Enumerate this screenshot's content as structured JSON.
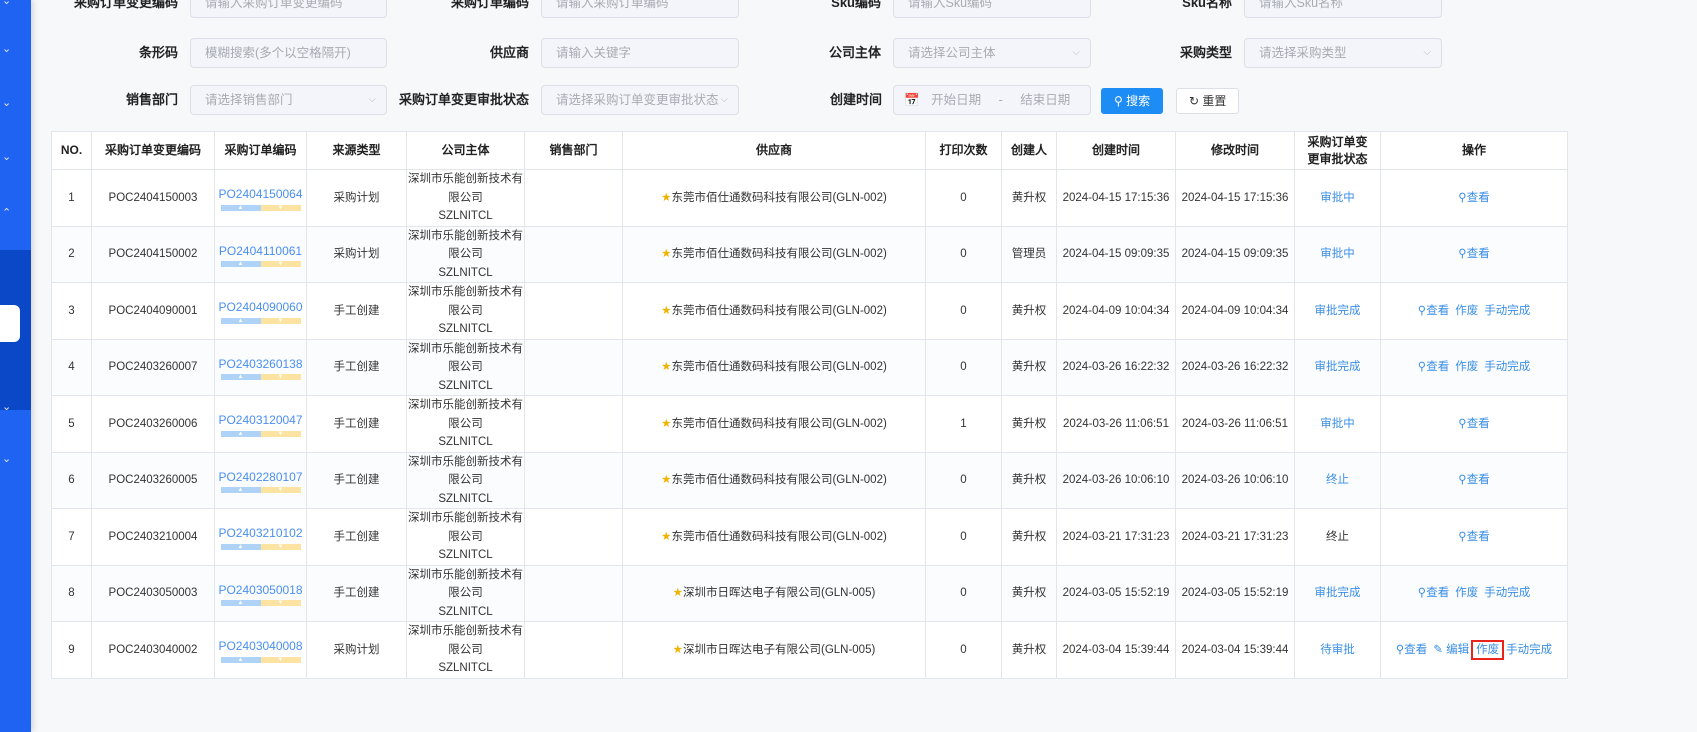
{
  "filters": [
    {
      "label": "采购订单变更编码",
      "placeholder": "请输入采购订单变更编码",
      "select": false
    },
    {
      "label": "采购订单编码",
      "placeholder": "请输入采购订单编码",
      "select": false
    },
    {
      "label": "Sku编码",
      "placeholder": "请输入Sku编码",
      "select": false
    },
    {
      "label": "Sku名称",
      "placeholder": "请输入Sku名称",
      "select": false
    },
    {
      "label": "条形码",
      "placeholder": "模糊搜索(多个以空格隔开)",
      "select": false
    },
    {
      "label": "供应商",
      "placeholder": "请输入关键字",
      "select": false
    },
    {
      "label": "公司主体",
      "placeholder": "请选择公司主体",
      "select": true
    },
    {
      "label": "采购类型",
      "placeholder": "请选择采购类型",
      "select": true
    },
    {
      "label": "销售部门",
      "placeholder": "请选择销售部门",
      "select": true
    },
    {
      "label": "采购订单变更审批状态",
      "placeholder": "请选择采购订单变更审批状态",
      "select": true
    }
  ],
  "date_filter": {
    "label": "创建时间",
    "start": "开始日期",
    "sep": "-",
    "end": "结束日期"
  },
  "buttons": {
    "search": "搜索",
    "reset": "重置"
  },
  "columns": [
    "NO.",
    "采购订单变更编码",
    "采购订单编码",
    "来源类型",
    "公司主体",
    "销售部门",
    "供应商",
    "打印次数",
    "创建人",
    "创建时间",
    "修改时间",
    "采购订单变更审批状态",
    "操作"
  ],
  "company": [
    "深圳市乐能创新技术有",
    "限公司",
    "SZLNITCL"
  ],
  "rows": [
    {
      "no": "1",
      "change_code": "POC2404150003",
      "po": "PO2404150064",
      "source": "采购计划",
      "dept": "",
      "supplier": "东莞市佰仕通数码科技有限公司(GLN-002)",
      "prints": "0",
      "creator": "黄升权",
      "created": "2024-04-15 17:15:36",
      "modified": "2024-04-15 17:15:36",
      "status": "审批中",
      "status_plain": false,
      "actions": [
        "查看"
      ]
    },
    {
      "no": "2",
      "change_code": "POC2404150002",
      "po": "PO2404110061",
      "source": "采购计划",
      "dept": "",
      "supplier": "东莞市佰仕通数码科技有限公司(GLN-002)",
      "prints": "0",
      "creator": "管理员",
      "created": "2024-04-15 09:09:35",
      "modified": "2024-04-15 09:09:35",
      "status": "审批中",
      "status_plain": false,
      "actions": [
        "查看"
      ]
    },
    {
      "no": "3",
      "change_code": "POC2404090001",
      "po": "PO2404090060",
      "source": "手工创建",
      "dept": "",
      "supplier": "东莞市佰仕通数码科技有限公司(GLN-002)",
      "prints": "0",
      "creator": "黄升权",
      "created": "2024-04-09 10:04:34",
      "modified": "2024-04-09 10:04:34",
      "status": "审批完成",
      "status_plain": false,
      "actions": [
        "查看",
        "作废",
        "手动完成"
      ]
    },
    {
      "no": "4",
      "change_code": "POC2403260007",
      "po": "PO2403260138",
      "source": "手工创建",
      "dept": "",
      "supplier": "东莞市佰仕通数码科技有限公司(GLN-002)",
      "prints": "0",
      "creator": "黄升权",
      "created": "2024-03-26 16:22:32",
      "modified": "2024-03-26 16:22:32",
      "status": "审批完成",
      "status_plain": false,
      "actions": [
        "查看",
        "作废",
        "手动完成"
      ]
    },
    {
      "no": "5",
      "change_code": "POC2403260006",
      "po": "PO2403120047",
      "source": "手工创建",
      "dept": "",
      "supplier": "东莞市佰仕通数码科技有限公司(GLN-002)",
      "prints": "1",
      "creator": "黄升权",
      "created": "2024-03-26 11:06:51",
      "modified": "2024-03-26 11:06:51",
      "status": "审批中",
      "status_plain": false,
      "actions": [
        "查看"
      ]
    },
    {
      "no": "6",
      "change_code": "POC2403260005",
      "po": "PO2402280107",
      "source": "手工创建",
      "dept": "",
      "supplier": "东莞市佰仕通数码科技有限公司(GLN-002)",
      "prints": "0",
      "creator": "黄升权",
      "created": "2024-03-26 10:06:10",
      "modified": "2024-03-26 10:06:10",
      "status": "终止",
      "status_plain": false,
      "actions": [
        "查看"
      ]
    },
    {
      "no": "7",
      "change_code": "POC2403210004",
      "po": "PO2403210102",
      "source": "手工创建",
      "dept": "",
      "supplier": "东莞市佰仕通数码科技有限公司(GLN-002)",
      "prints": "0",
      "creator": "黄升权",
      "created": "2024-03-21 17:31:23",
      "modified": "2024-03-21 17:31:23",
      "status": "终止",
      "status_plain": true,
      "actions": [
        "查看"
      ]
    },
    {
      "no": "8",
      "change_code": "POC2403050003",
      "po": "PO2403050018",
      "source": "手工创建",
      "dept": "",
      "supplier": "深圳市日晖达电子有限公司(GLN-005)",
      "prints": "0",
      "creator": "黄升权",
      "created": "2024-03-05 15:52:19",
      "modified": "2024-03-05 15:52:19",
      "status": "审批完成",
      "status_plain": false,
      "actions": [
        "查看",
        "作废",
        "手动完成"
      ]
    },
    {
      "no": "9",
      "change_code": "POC2403040002",
      "po": "PO2403040008",
      "source": "采购计划",
      "dept": "",
      "supplier": "深圳市日晖达电子有限公司(GLN-005)",
      "prints": "0",
      "creator": "黄升权",
      "created": "2024-03-04 15:39:44",
      "modified": "2024-03-04 15:39:44",
      "status": "待审批",
      "status_plain": false,
      "actions": [
        "查看",
        "编辑",
        "作废",
        "手动完成"
      ],
      "highlight": "作废"
    }
  ]
}
